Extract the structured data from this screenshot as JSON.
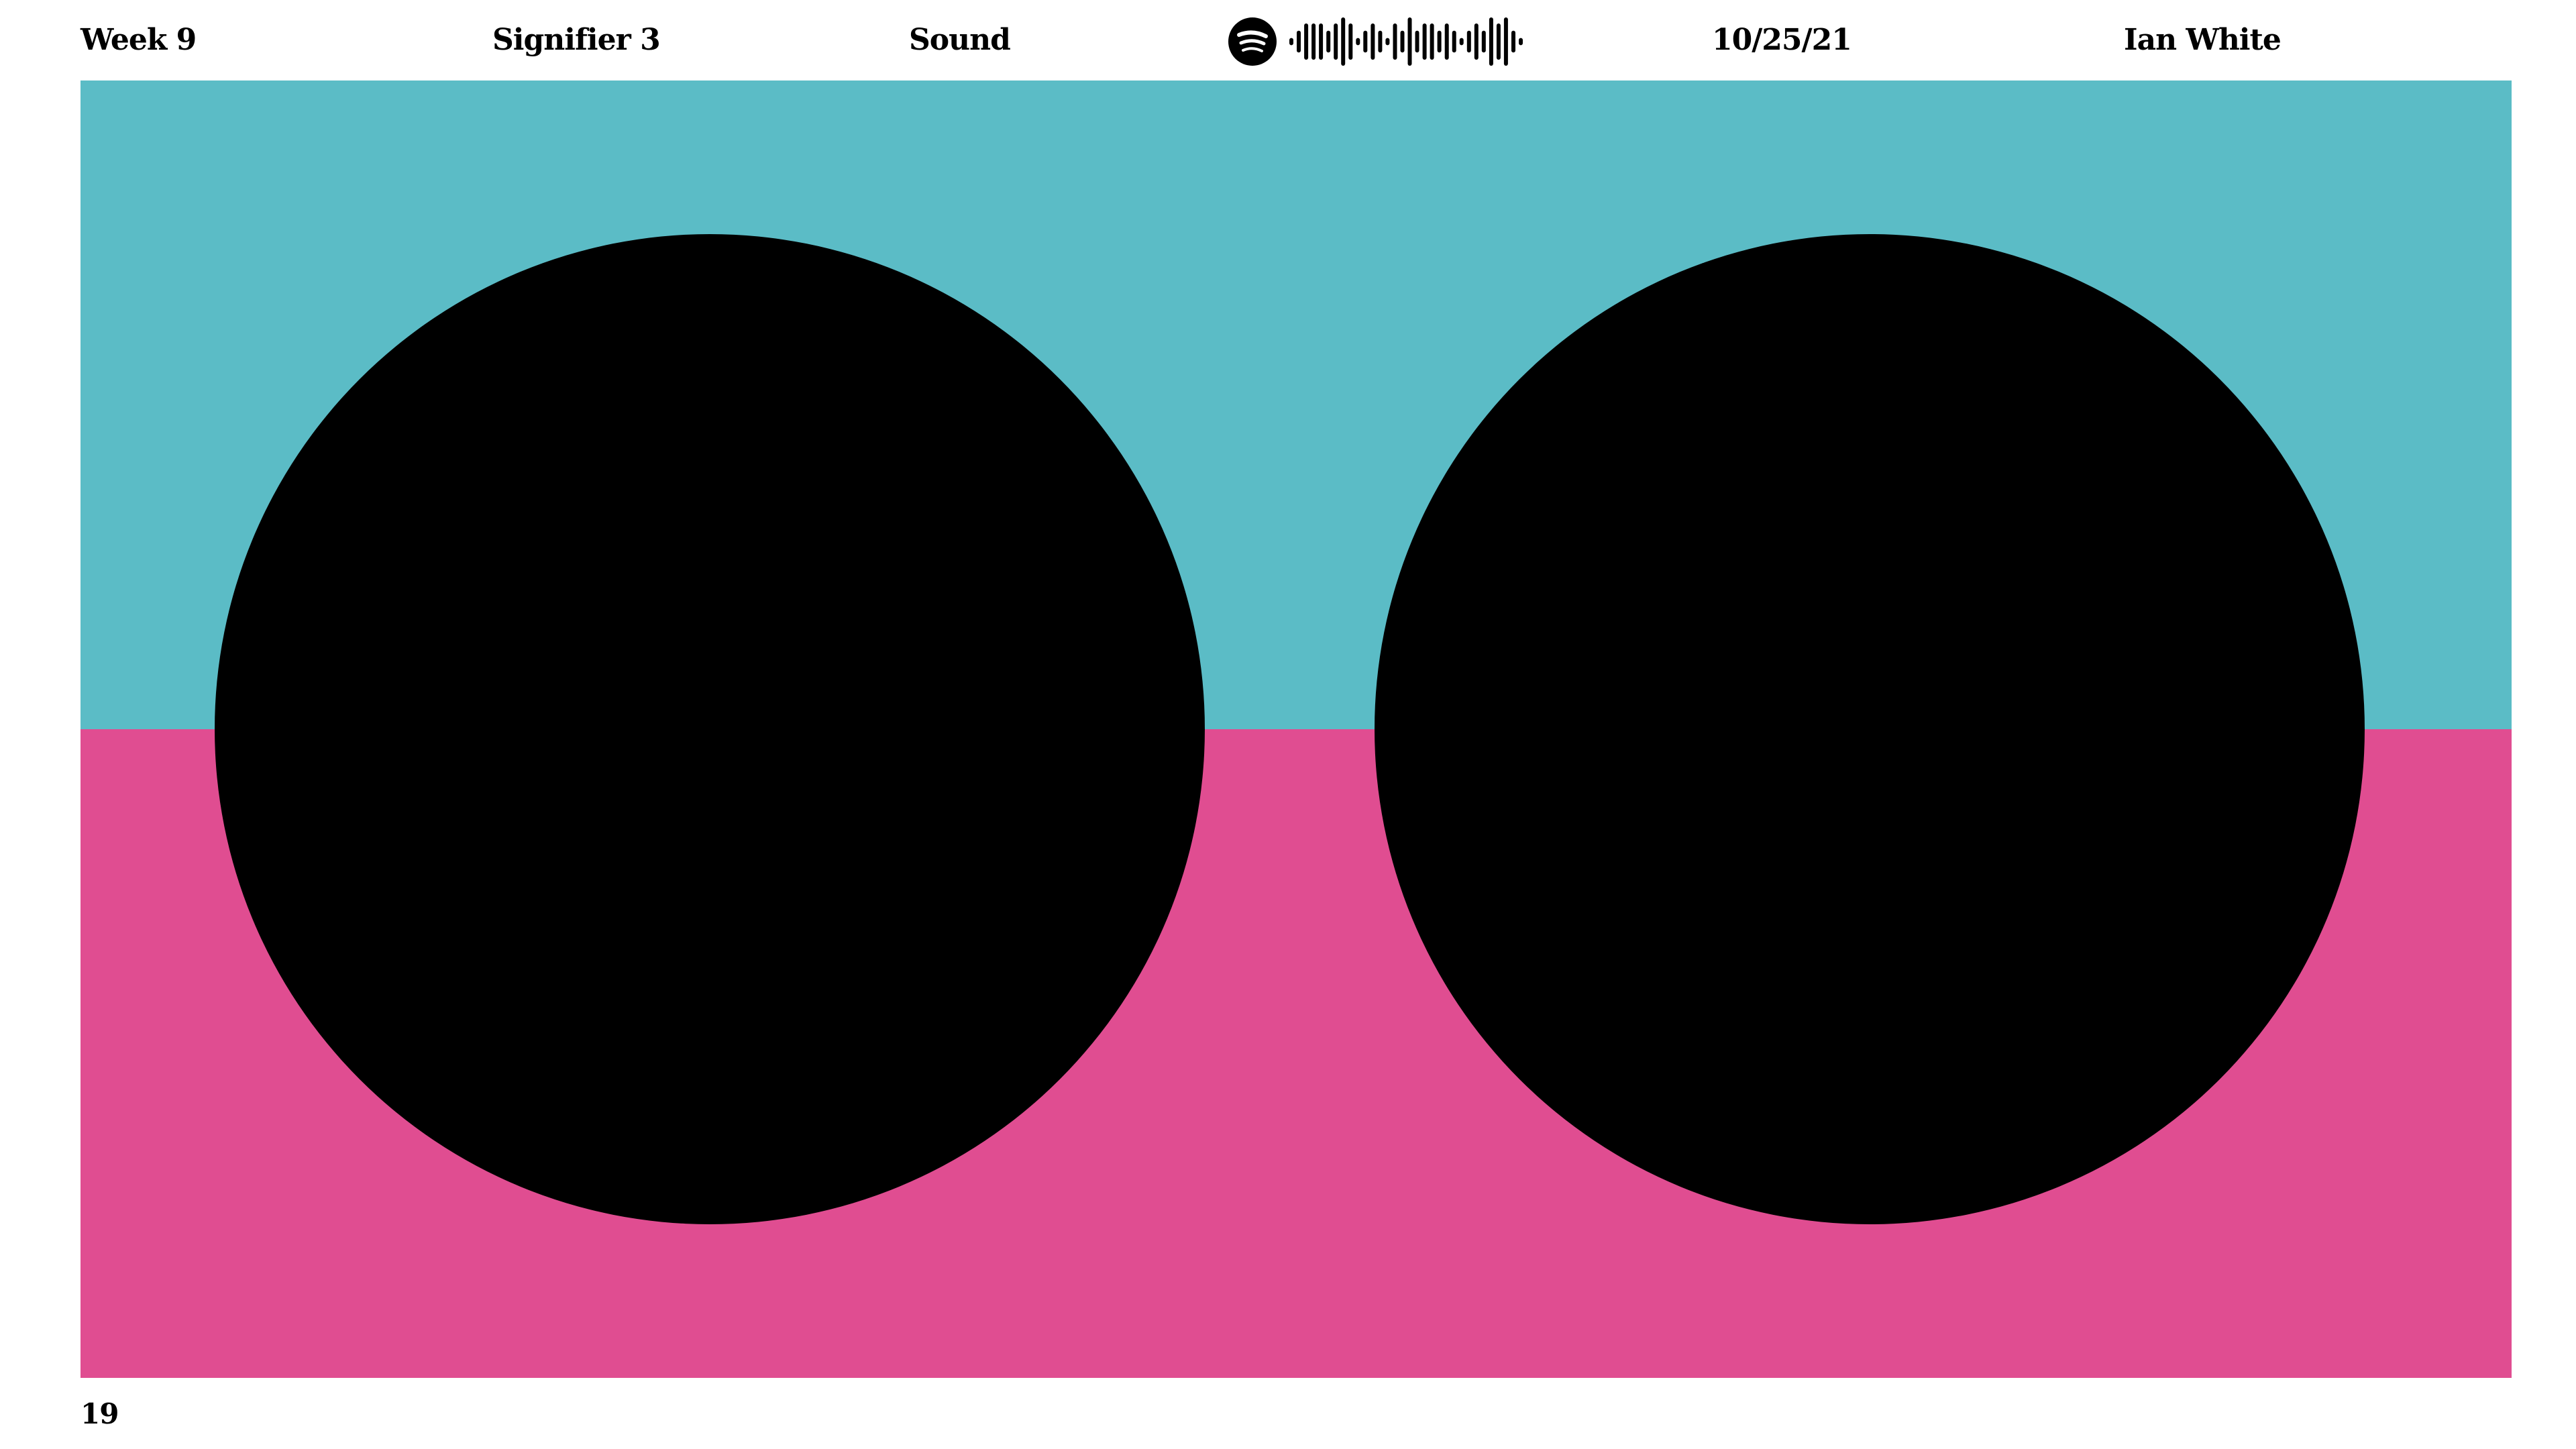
{
  "header": {
    "week": "Week  9",
    "signifier": "Signifier 3",
    "topic": "Sound",
    "date": "10/25/21",
    "author": "Ian White"
  },
  "spotify_code": {
    "logo_icon": "spotify-icon",
    "bars_icon": "spotify-code-bars",
    "bar_levels": [
      0.15,
      0.45,
      0.75,
      0.75,
      0.75,
      0.45,
      0.75,
      1.0,
      0.75,
      0.15,
      0.45,
      0.75,
      0.45,
      0.15,
      0.75,
      0.45,
      1.0,
      0.45,
      0.75,
      0.75,
      0.45,
      0.75,
      0.45,
      0.15,
      0.45,
      0.75,
      0.45,
      1.0,
      0.75,
      1.0,
      0.45,
      0.15
    ]
  },
  "composition": {
    "top_color": "#5bbcc6",
    "bottom_color": "#e04d91",
    "circle_color": "#000000"
  },
  "footer": {
    "page_number": "19"
  }
}
